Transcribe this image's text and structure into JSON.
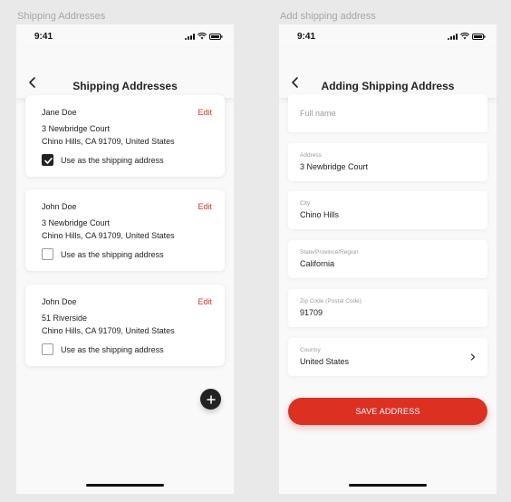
{
  "frames": {
    "left_label": "Shipping Addresses",
    "right_label": "Add shipping address"
  },
  "status_bar": {
    "time": "9:41"
  },
  "shipping_addresses": {
    "title": "Shipping Addresses",
    "addresses": [
      {
        "name": "Jane Doe",
        "edit_label": "Edit",
        "line1": "3 Newbridge Court",
        "line2": "Chino Hills, CA 91709, United States",
        "checkbox_label": "Use as the shipping address",
        "checked": true
      },
      {
        "name": "John Doe",
        "edit_label": "Edit",
        "line1": "3 Newbridge Court",
        "line2": "Chino Hills, CA 91709, United States",
        "checkbox_label": "Use as the shipping address",
        "checked": false
      },
      {
        "name": "John Doe",
        "edit_label": "Edit",
        "line1": "51 Riverside",
        "line2": "Chino Hills, CA 91709, United States",
        "checkbox_label": "Use as the shipping address",
        "checked": false
      }
    ],
    "add_icon": "plus-icon"
  },
  "add_address": {
    "title": "Adding Shipping Address",
    "fields": {
      "full_name": {
        "placeholder": "Full name"
      },
      "address": {
        "label": "Address",
        "value": "3 Newbridge Court"
      },
      "city": {
        "label": "City",
        "value": "Chino Hills"
      },
      "state": {
        "label": "State/Province/Region",
        "value": "California"
      },
      "zip": {
        "label": "Zip Code (Postal Code)",
        "value": "91709"
      },
      "country": {
        "label": "Country",
        "value": "United States"
      }
    },
    "save_label": "SAVE ADDRESS"
  },
  "colors": {
    "accent": "#db3022",
    "background": "#f9f9f9",
    "text": "#222222"
  }
}
